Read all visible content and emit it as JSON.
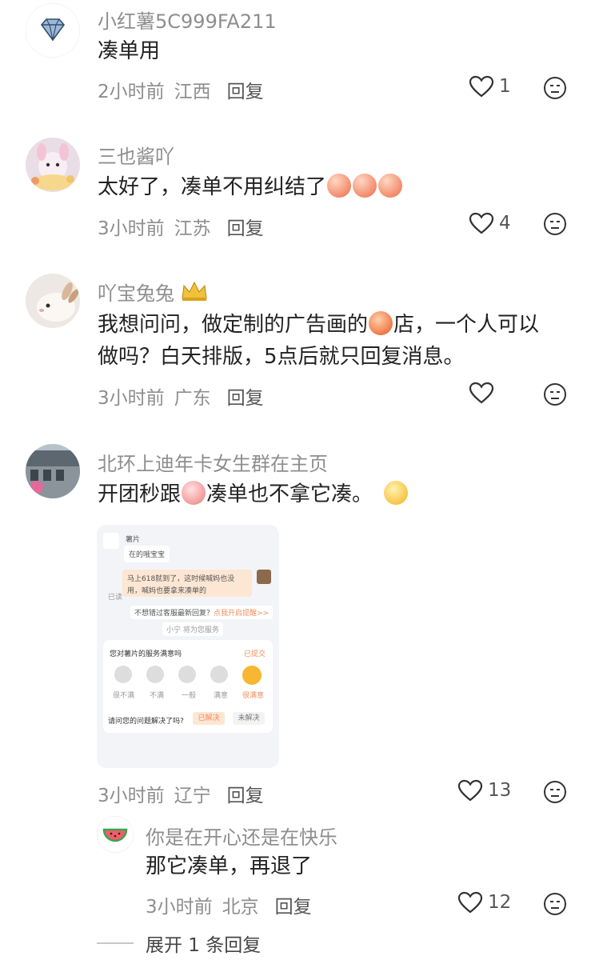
{
  "comments": [
    {
      "username": "小红薯5C999FA211",
      "content": "凑单用",
      "time": "2小时前",
      "location": "江西",
      "reply_label": "回复",
      "likes": "1",
      "avatar": "diamond-icon"
    },
    {
      "username": "三也酱吖",
      "content": "太好了，凑单不用纠结了",
      "time": "3小时前",
      "location": "江苏",
      "reply_label": "回复",
      "likes": "4",
      "avatar": "plush-toy-photo"
    },
    {
      "username": "吖宝兔兔",
      "content_line1_a": "我想问问，做定制的广告画的",
      "content_line1_b": "店，一个人可以",
      "content_line2": "做吗？白天排版，5点后就只回复消息。",
      "time": "3小时前",
      "location": "广东",
      "reply_label": "回复",
      "likes": "",
      "avatar": "bunny-photo"
    },
    {
      "username": "北环上迪年卡女生群在主页",
      "content_a": "开团秒跟",
      "content_b": "凑单也不拿它凑。",
      "time": "3小时前",
      "location": "辽宁",
      "reply_label": "回复",
      "likes": "13",
      "avatar": "street-photo",
      "screenshot": {
        "shop_name": "薯片",
        "bubble1": "在的哦宝宝",
        "bubble2_line1": "马上618就到了，这时候喊妈也没",
        "bubble2_line2": "用，喊妈也要拿来凑单的",
        "read_label": "已读",
        "notice": "不想错过客服最新回复？",
        "notice_link": "点我开启提醒>>",
        "service_note": "小宁 将为您服务",
        "survey_title": "您对薯片的服务满意吗",
        "submitted": "已提交",
        "ratings": [
          "很不满",
          "不满",
          "一般",
          "满意",
          "很满意"
        ],
        "resolved_question": "请问您的问题解决了吗?",
        "resolved_yes": "已解决",
        "resolved_no": "未解决"
      }
    }
  ],
  "sub_reply": {
    "username": "你是在开心还是在快乐",
    "content": "那它凑单，再退了",
    "time": "3小时前",
    "location": "北京",
    "reply_label": "回复",
    "likes": "12",
    "avatar": "watermelon-icon"
  },
  "expand_label": "展开 1 条回复",
  "colors": {
    "text": "#222222",
    "meta": "#8e8e8e",
    "accent": "#f28c5c"
  }
}
